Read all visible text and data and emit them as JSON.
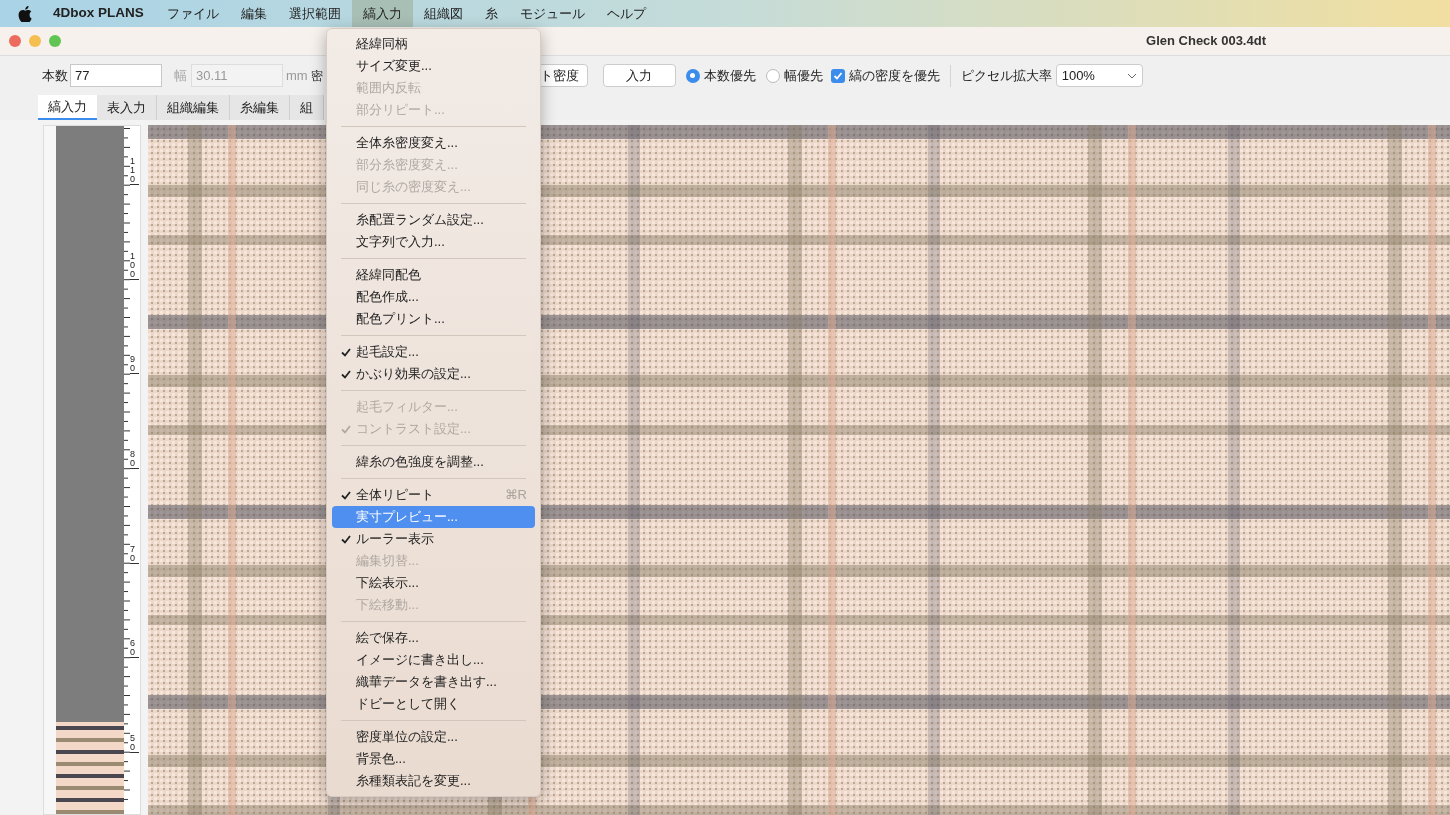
{
  "menu_bar": {
    "app_name": "4Dbox PLANS",
    "items": [
      {
        "label": "ファイル",
        "selected": false
      },
      {
        "label": "編集",
        "selected": false
      },
      {
        "label": "選択範囲",
        "selected": false
      },
      {
        "label": "縞入力",
        "selected": true
      },
      {
        "label": "組織図",
        "selected": false
      },
      {
        "label": "糸",
        "selected": false
      },
      {
        "label": "モジュール",
        "selected": false
      },
      {
        "label": "ヘルプ",
        "selected": false
      }
    ]
  },
  "window": {
    "title": "Glen Check 003.4dt"
  },
  "toolbar": {
    "count_label": "本数",
    "count_value": "77",
    "width_label": "幅",
    "width_value": "30.11",
    "width_disabled": true,
    "unit": "mm",
    "density_label_partial": "密",
    "density_button_partial": "ト密度",
    "input_button": "入力",
    "radios": [
      {
        "label": "本数優先",
        "selected": true
      },
      {
        "label": "幅優先",
        "selected": false
      }
    ],
    "checkbox": {
      "label": "縞の密度を優先",
      "checked": true
    },
    "zoom_label": "ピクセル拡大率",
    "zoom_value": "100%"
  },
  "tabs": [
    {
      "label": "縞入力",
      "selected": true
    },
    {
      "label": "表入力",
      "selected": false
    },
    {
      "label": "組織編集",
      "selected": false
    },
    {
      "label": "糸編集",
      "selected": false
    },
    {
      "label": "組",
      "selected": false
    }
  ],
  "ruler": {
    "labels": [
      "110",
      "100",
      "90",
      "80",
      "70",
      "60",
      "50"
    ]
  },
  "dropdown_menu": [
    {
      "kind": "item",
      "label": "経緯同柄",
      "disabled": false,
      "checked": false,
      "selected": false
    },
    {
      "kind": "item",
      "label": "サイズ変更...",
      "disabled": false,
      "checked": false,
      "selected": false
    },
    {
      "kind": "item",
      "label": "範囲内反転",
      "disabled": true,
      "checked": false,
      "selected": false
    },
    {
      "kind": "item",
      "label": "部分リピート...",
      "disabled": true,
      "checked": false,
      "selected": false
    },
    {
      "kind": "separator"
    },
    {
      "kind": "item",
      "label": "全体糸密度変え...",
      "disabled": false,
      "checked": false,
      "selected": false
    },
    {
      "kind": "item",
      "label": "部分糸密度変え...",
      "disabled": true,
      "checked": false,
      "selected": false
    },
    {
      "kind": "item",
      "label": "同じ糸の密度変え...",
      "disabled": true,
      "checked": false,
      "selected": false
    },
    {
      "kind": "separator"
    },
    {
      "kind": "item",
      "label": "糸配置ランダム設定...",
      "disabled": false,
      "checked": false,
      "selected": false
    },
    {
      "kind": "item",
      "label": "文字列で入力...",
      "disabled": false,
      "checked": false,
      "selected": false
    },
    {
      "kind": "separator"
    },
    {
      "kind": "item",
      "label": "経緯同配色",
      "disabled": false,
      "checked": false,
      "selected": false
    },
    {
      "kind": "item",
      "label": "配色作成...",
      "disabled": false,
      "checked": false,
      "selected": false
    },
    {
      "kind": "item",
      "label": "配色プリント...",
      "disabled": false,
      "checked": false,
      "selected": false
    },
    {
      "kind": "separator"
    },
    {
      "kind": "item",
      "label": "起毛設定...",
      "disabled": false,
      "checked": true,
      "selected": false
    },
    {
      "kind": "item",
      "label": "かぶり効果の設定...",
      "disabled": false,
      "checked": true,
      "selected": false
    },
    {
      "kind": "separator"
    },
    {
      "kind": "item",
      "label": "起毛フィルター...",
      "disabled": true,
      "checked": false,
      "selected": false
    },
    {
      "kind": "item",
      "label": "コントラスト設定...",
      "disabled": true,
      "checked": true,
      "selected": false
    },
    {
      "kind": "separator"
    },
    {
      "kind": "item",
      "label": "緯糸の色強度を調整...",
      "disabled": false,
      "checked": false,
      "selected": false
    },
    {
      "kind": "separator"
    },
    {
      "kind": "item",
      "label": "全体リピート",
      "disabled": false,
      "checked": true,
      "selected": false,
      "shortcut": "⌘R"
    },
    {
      "kind": "item",
      "label": "実寸プレビュー...",
      "disabled": false,
      "checked": false,
      "selected": true
    },
    {
      "kind": "item",
      "label": "ルーラー表示",
      "disabled": false,
      "checked": true,
      "selected": false
    },
    {
      "kind": "item",
      "label": "編集切替...",
      "disabled": true,
      "checked": false,
      "selected": false
    },
    {
      "kind": "item",
      "label": "下絵表示...",
      "disabled": false,
      "checked": false,
      "selected": false
    },
    {
      "kind": "item",
      "label": "下絵移動...",
      "disabled": true,
      "checked": false,
      "selected": false
    },
    {
      "kind": "separator"
    },
    {
      "kind": "item",
      "label": "絵で保存...",
      "disabled": false,
      "checked": false,
      "selected": false
    },
    {
      "kind": "item",
      "label": "イメージに書き出し...",
      "disabled": false,
      "checked": false,
      "selected": false
    },
    {
      "kind": "item",
      "label": "織華データを書き出す...",
      "disabled": false,
      "checked": false,
      "selected": false
    },
    {
      "kind": "item",
      "label": "ドビーとして開く",
      "disabled": false,
      "checked": false,
      "selected": false
    },
    {
      "kind": "separator"
    },
    {
      "kind": "item",
      "label": "密度単位の設定...",
      "disabled": false,
      "checked": false,
      "selected": false
    },
    {
      "kind": "item",
      "label": "背景色...",
      "disabled": false,
      "checked": false,
      "selected": false
    },
    {
      "kind": "item",
      "label": "糸種類表記を変更...",
      "disabled": false,
      "checked": false,
      "selected": false
    }
  ]
}
